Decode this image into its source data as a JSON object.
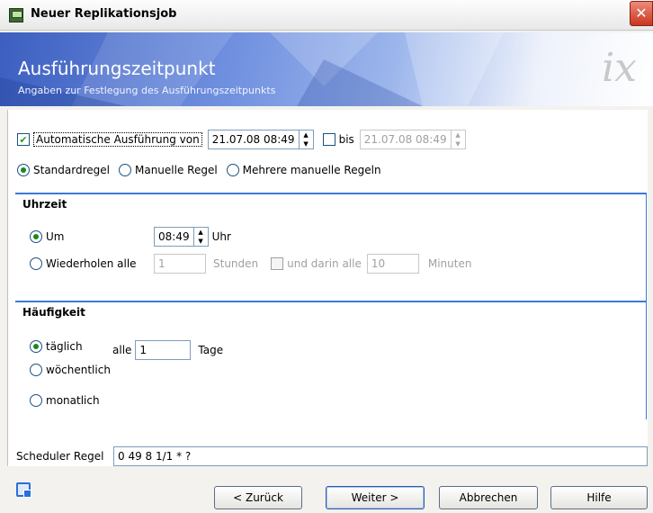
{
  "window": {
    "title": "Neuer Replikationsjob",
    "close_label": "✕"
  },
  "banner": {
    "title": "Ausführungszeitpunkt",
    "subtitle": "Angaben zur Festlegung des Ausführungszeitpunkts",
    "logo": "ix"
  },
  "auto_exec": {
    "checkbox_checked": true,
    "label": "Automatische Ausführung von",
    "from_value": "21.07.08 08:49",
    "until_checked": false,
    "until_label": "bis",
    "until_value": "21.07.08 08:49"
  },
  "rule_mode": {
    "options": [
      "Standardregel",
      "Manuelle Regel",
      "Mehrere manuelle Regeln"
    ],
    "selected": "Standardregel"
  },
  "uhrzeit": {
    "title": "Uhrzeit",
    "um_label": "Um",
    "um_value": "08:49",
    "um_unit": "Uhr",
    "repeat_label": "Wiederholen alle",
    "repeat_value": "1",
    "repeat_unit": "Stunden",
    "within_label": "und darin alle",
    "within_value": "10",
    "within_unit": "Minuten",
    "selected": "Um"
  },
  "haeufigkeit": {
    "title": "Häufigkeit",
    "options": [
      "täglich",
      "wöchentlich",
      "monatlich"
    ],
    "selected": "täglich",
    "every_label": "alle",
    "every_value": "1",
    "every_unit": "Tage"
  },
  "scheduler": {
    "label": "Scheduler Regel",
    "value": "0 49 8 1/1 * ?"
  },
  "buttons": {
    "back": "< Zurück",
    "next": "Weiter >",
    "cancel": "Abbrechen",
    "help": "Hilfe"
  },
  "colors": {
    "accent": "#3a7bd5",
    "banner_dark": "#3c5fc0",
    "close_red": "#c8361f"
  }
}
